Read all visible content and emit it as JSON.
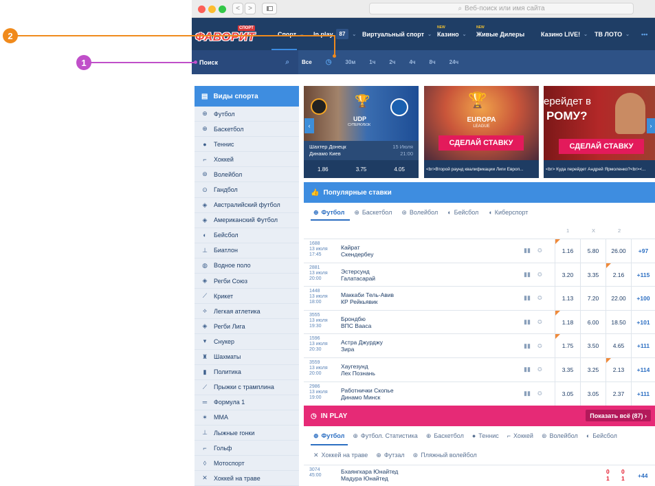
{
  "callouts": {
    "one": "1",
    "two": "2"
  },
  "browser": {
    "address_placeholder": "Веб-поиск или имя сайта",
    "nav_back": "<",
    "nav_forward": ">"
  },
  "site": {
    "logo_badge": "СПОРТ",
    "logo_text": "ФАВОРИТ",
    "nav": [
      {
        "label": "Спорт"
      },
      {
        "label": "In play",
        "count": "87"
      },
      {
        "label": "Виртуальный спорт"
      },
      {
        "label": "Казино",
        "badge": "NEW"
      },
      {
        "label": "Живые Дилеры",
        "badge": "NEW"
      },
      {
        "label": "Казино LIVE!"
      },
      {
        "label": "ТВ ЛОТО"
      },
      {
        "label": "•••"
      }
    ],
    "search_label": "Поиск",
    "time_filters": [
      "Все",
      "30м",
      "1ч",
      "2ч",
      "4ч",
      "8ч",
      "24ч"
    ]
  },
  "sidebar": {
    "title": "Виды спорта",
    "items": [
      {
        "label": "Футбол",
        "icon": "⊕"
      },
      {
        "label": "Баскетбол",
        "icon": "⊕"
      },
      {
        "label": "Теннис",
        "icon": "●"
      },
      {
        "label": "Хоккей",
        "icon": "⌐"
      },
      {
        "label": "Волейбол",
        "icon": "⊛"
      },
      {
        "label": "Гандбол",
        "icon": "⊙"
      },
      {
        "label": "Австралийский футбол",
        "icon": "◈"
      },
      {
        "label": "Американский Футбол",
        "icon": "◈"
      },
      {
        "label": "Бейсбол",
        "icon": "◐"
      },
      {
        "label": "Биатлон",
        "icon": "⊥"
      },
      {
        "label": "Водное поло",
        "icon": "◍"
      },
      {
        "label": "Регби Союз",
        "icon": "◈"
      },
      {
        "label": "Крикет",
        "icon": "⟋"
      },
      {
        "label": "Легкая атлетика",
        "icon": "⟡"
      },
      {
        "label": "Регби Лига",
        "icon": "◈"
      },
      {
        "label": "Снукер",
        "icon": "▾"
      },
      {
        "label": "Шахматы",
        "icon": "♜"
      },
      {
        "label": "Политика",
        "icon": "▮"
      },
      {
        "label": "Прыжки с трамплина",
        "icon": "⟋"
      },
      {
        "label": "Формула 1",
        "icon": "═"
      },
      {
        "label": "MMA",
        "icon": "✶"
      },
      {
        "label": "Лыжные гонки",
        "icon": "⊥"
      },
      {
        "label": "Гольф",
        "icon": "⌐"
      },
      {
        "label": "Мотоспорт",
        "icon": "◊"
      },
      {
        "label": "Хоккей на траве",
        "icon": "✕"
      }
    ]
  },
  "banners": {
    "match": {
      "team1": "Шахтер Донецк",
      "team2": "Динамо Киев",
      "date": "15 Июля",
      "time": "21:00",
      "trophy": "UDP",
      "trophy_sub": "СУПЕРКУБОК",
      "odds": [
        "1.86",
        "3.75",
        "4.05"
      ]
    },
    "europa": {
      "logo1": "EUROPA",
      "logo2": "LEAGUE",
      "cta": "СДЕЛАЙ СТАВКУ",
      "caption": "<br>Второй раунд квалификации Лиги Европ..."
    },
    "transfer": {
      "line1": "ерейдет в",
      "line2": "РОМУ?",
      "cta": "СДЕЛАЙ СТАВКУ",
      "caption": "<br> Куда перейдет Андрей Ярмоленко?<br><..."
    }
  },
  "popular": {
    "title": "Популярные ставки",
    "tabs": [
      "Футбол",
      "Баскетбол",
      "Волейбол",
      "Бейсбол",
      "Киберспорт"
    ],
    "cols": [
      "1",
      "X",
      "2"
    ],
    "rows": [
      {
        "id": "1688",
        "date": "13 июля",
        "time": "17:45",
        "t1": "Кайрат",
        "t2": "Скендербеу",
        "o1": "1.16",
        "ox": "5.80",
        "o2": "26.00",
        "more": "+97",
        "mark": "o1"
      },
      {
        "id": "2881",
        "date": "13 июля",
        "time": "20:00",
        "t1": "Эстерсунд",
        "t2": "Галатасарай",
        "o1": "3.20",
        "ox": "3.35",
        "o2": "2.16",
        "more": "+115",
        "mark": "o2"
      },
      {
        "id": "1448",
        "date": "13 июля",
        "time": "18:00",
        "t1": "Маккаби Тель-Авив",
        "t2": "КР Рейкьявик",
        "o1": "1.13",
        "ox": "7.20",
        "o2": "22.00",
        "more": "+100",
        "mark": ""
      },
      {
        "id": "3555",
        "date": "13 июля",
        "time": "19:30",
        "t1": "Брондбю",
        "t2": "ВПС Вааса",
        "o1": "1.18",
        "ox": "6.00",
        "o2": "18.50",
        "more": "+101",
        "mark": "o1"
      },
      {
        "id": "1596",
        "date": "13 июля",
        "time": "20:30",
        "t1": "Астра Джурджу",
        "t2": "Зира",
        "o1": "1.75",
        "ox": "3.50",
        "o2": "4.65",
        "more": "+111",
        "mark": "o1"
      },
      {
        "id": "3559",
        "date": "13 июля",
        "time": "20:00",
        "t1": "Хаугезунд",
        "t2": "Лех Познань",
        "o1": "3.35",
        "ox": "3.25",
        "o2": "2.13",
        "more": "+114",
        "mark": "o2"
      },
      {
        "id": "2986",
        "date": "13 июля",
        "time": "19:00",
        "t1": "Работнички Скопье",
        "t2": "Динамо Минск",
        "o1": "3.05",
        "ox": "3.05",
        "o2": "2.37",
        "more": "+111",
        "mark": ""
      }
    ]
  },
  "inplay": {
    "title": "IN PLAY",
    "show_all": "Показать всё (87) ›",
    "tabs": [
      "Футбол",
      "Футбол. Статистика",
      "Баскетбол",
      "Теннис",
      "Хоккей",
      "Волейбол",
      "Бейсбол"
    ],
    "tabs2": [
      "Хоккей на траве",
      "Футзал",
      "Пляжный волейбол"
    ],
    "row": {
      "id": "3074",
      "time": "45:00",
      "t1": "Бхаянгкара Юнайтед",
      "t2": "Мадура Юнайтед",
      "s1a": "0",
      "s1b": "0",
      "s2a": "1",
      "s2b": "1",
      "more": "+44"
    }
  },
  "colors": {
    "header": "#1f3e66",
    "accent_blue": "#3e8de0",
    "inplay_pink": "#e62a76",
    "cta_red": "#e31a5b"
  }
}
